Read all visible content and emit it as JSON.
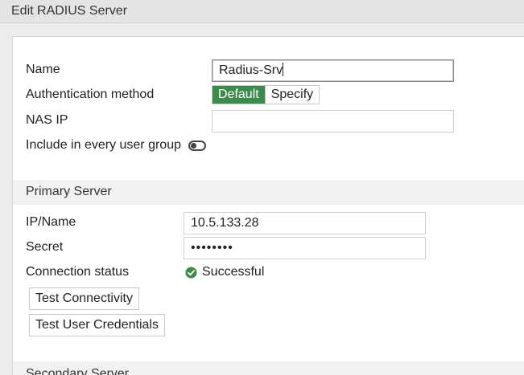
{
  "header": {
    "title": "Edit RADIUS Server"
  },
  "form": {
    "name_label": "Name",
    "name_value": "Radius-Srv",
    "auth_method_label": "Authentication method",
    "auth_options": [
      "Default",
      "Specify"
    ],
    "auth_selected": "Default",
    "nas_ip_label": "NAS IP",
    "nas_ip_value": "",
    "include_label": "Include in every user group",
    "include_enabled": false
  },
  "primary": {
    "section_title": "Primary Server",
    "ip_label": "IP/Name",
    "ip_value": "10.5.133.28",
    "secret_label": "Secret",
    "secret_value": "••••••••",
    "conn_label": "Connection status",
    "conn_status": "Successful",
    "test_conn_button": "Test Connectivity",
    "test_user_button": "Test User Credentials"
  },
  "secondary": {
    "section_title": "Secondary Server"
  },
  "colors": {
    "accent": "#3d8b4c",
    "success": "#3d8b4c"
  },
  "icons": {
    "status_icon": "check-circle-icon",
    "toggle_icon": "toggle-off-icon"
  }
}
